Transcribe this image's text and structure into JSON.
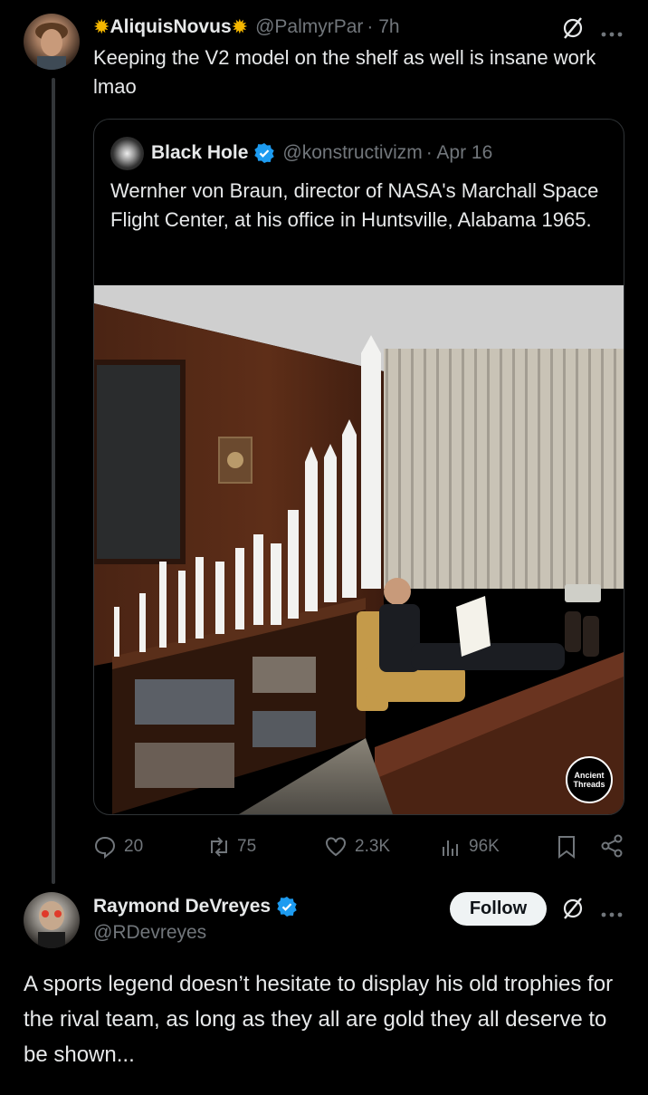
{
  "reply_post": {
    "display_name": "AliquisNovus",
    "handle": "@PalmyrPar",
    "time": "· 7h",
    "text": "Keeping the V2 model on the shelf as well is insane work lmao"
  },
  "quoted_post": {
    "display_name": "Black Hole",
    "handle": "@konstructivizm",
    "date": "· Apr 16",
    "text": "Wernher von Braun, director of NASA's Marchall Space Flight Center, at his office in Huntsville, Alabama 1965.",
    "watermark": "Ancient Threads"
  },
  "actions": {
    "replies": "20",
    "reposts": "75",
    "likes": "2.3K",
    "views": "96K"
  },
  "next_post": {
    "display_name": "Raymond DeVreyes",
    "handle": "@RDevreyes",
    "follow_label": "Follow",
    "text": "A sports legend doesn’t hesitate to display his old trophies for the rival team, as long as they all are gold they all deserve to be shown..."
  },
  "colors": {
    "background": "#000000",
    "text_primary": "#e7e9ea",
    "text_muted": "#71767b",
    "verified_blue": "#1d9bf0",
    "sun_emoji": "#f5b700"
  }
}
